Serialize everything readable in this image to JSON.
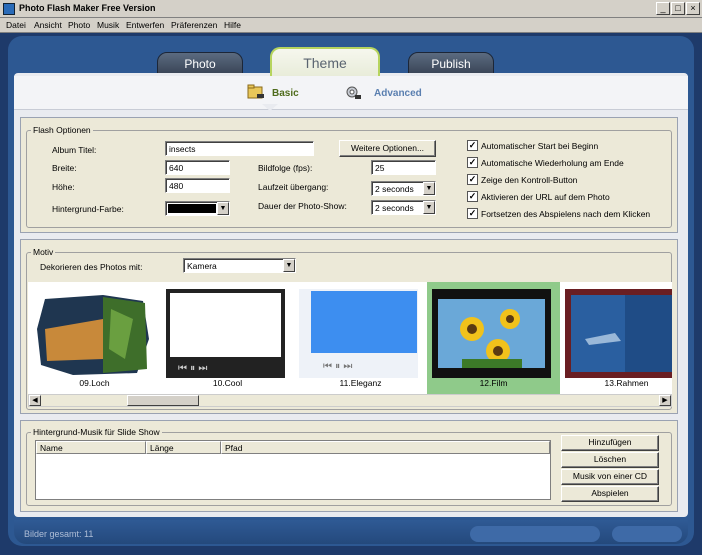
{
  "window": {
    "title": "Photo Flash Maker Free Version"
  },
  "menu": [
    "Datei",
    "Ansicht",
    "Photo",
    "Musik",
    "Entwerfen",
    "Präferenzen",
    "Hilfe"
  ],
  "tabs": [
    {
      "label": "Photo"
    },
    {
      "label": "Theme"
    },
    {
      "label": "Publish"
    }
  ],
  "subtabs": [
    {
      "label": "Basic"
    },
    {
      "label": "Advanced"
    }
  ],
  "flash": {
    "group_label": "Flash Optionen",
    "album_label": "Album Titel:",
    "album_value": "insects",
    "width_label": "Breite:",
    "width_value": "640",
    "height_label": "Höhe:",
    "height_value": "480",
    "bg_label": "Hintergrund-Farbe:",
    "bg_color": "#000000",
    "more_button": "Weitere Optionen...",
    "fps_label": "Bildfolge (fps):",
    "fps_value": "25",
    "transition_label": "Laufzeit übergang:",
    "transition_value": "2 seconds",
    "duration_label": "Dauer der Photo-Show:",
    "duration_value": "2 seconds",
    "checkboxes": [
      {
        "label": "Automatischer Start bei Beginn",
        "checked": true
      },
      {
        "label": "Automatische Wiederholung am Ende",
        "checked": true
      },
      {
        "label": "Zeige den Kontroll-Button",
        "checked": true
      },
      {
        "label": "Aktivieren der URL auf dem Photo",
        "checked": true
      },
      {
        "label": "Fortsetzen des Abspielens nach dem Klicken",
        "checked": true
      }
    ]
  },
  "motiv": {
    "group_label": "Motiv",
    "decorate_label": "Dekorieren des Photos mit:",
    "decorate_value": "Kamera",
    "thumbnails": [
      {
        "caption": "09.Loch",
        "selected": false
      },
      {
        "caption": "10.Cool",
        "selected": false
      },
      {
        "caption": "11.Eleganz",
        "selected": false
      },
      {
        "caption": "12.Film",
        "selected": true
      },
      {
        "caption": "13.Rahmen",
        "selected": false
      }
    ]
  },
  "music": {
    "group_label": "Hintergrund-Musik für Slide Show",
    "columns": [
      "Name",
      "Länge",
      "Pfad"
    ],
    "buttons": [
      "Hinzufügen",
      "Löschen",
      "Musik von einer CD laden",
      "Abspielen"
    ]
  },
  "status": {
    "text": "Bilder gesamt: 11"
  },
  "colors": {
    "accent": "#b6d45e",
    "selected_thumb": "#8fca8a",
    "frame": "#2d5892"
  }
}
